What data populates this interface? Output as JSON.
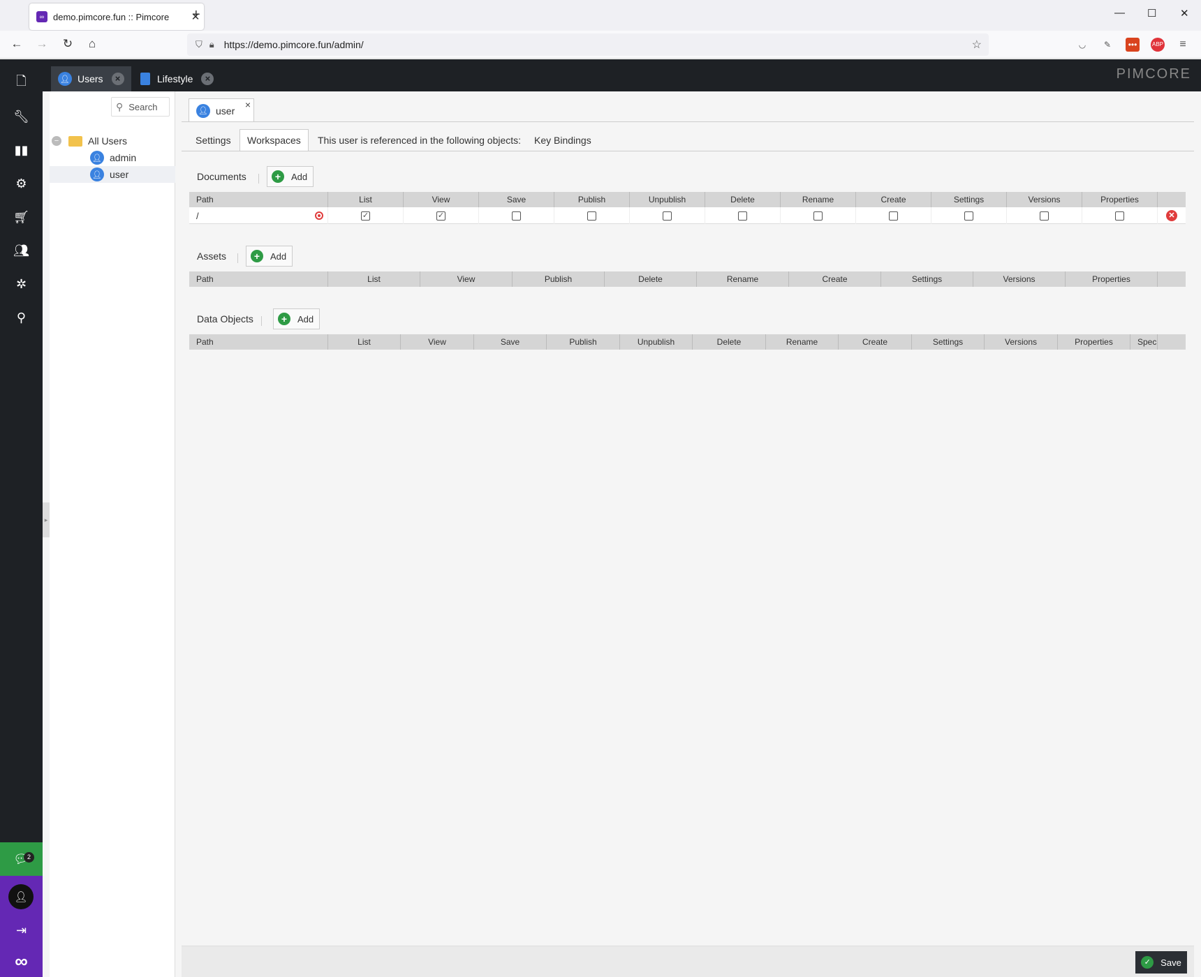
{
  "browser": {
    "tab_title": "demo.pimcore.fun :: Pimcore",
    "tab_close": "✕",
    "new_tab": "+",
    "url": "https://demo.pimcore.fun/admin/"
  },
  "app": {
    "brand": "PIMCORE",
    "top_tabs": [
      {
        "label": "Users"
      },
      {
        "label": "Lifestyle"
      }
    ],
    "notifications_count": "2"
  },
  "tree": {
    "search_label": "Search",
    "root": "All Users",
    "users": [
      "admin",
      "user"
    ]
  },
  "editor": {
    "tab_label": "user",
    "subtabs": [
      "Settings",
      "Workspaces",
      "This user is referenced in the following objects:",
      "Key Bindings"
    ],
    "add_label": "Add",
    "documents": {
      "title": "Documents",
      "columns": [
        "Path",
        "List",
        "View",
        "Save",
        "Publish",
        "Unpublish",
        "Delete",
        "Rename",
        "Create",
        "Settings",
        "Versions",
        "Properties"
      ],
      "rows": [
        {
          "path": "/",
          "checked": [
            true,
            true,
            false,
            false,
            false,
            false,
            false,
            false,
            false,
            false,
            false
          ]
        }
      ]
    },
    "assets": {
      "title": "Assets",
      "columns": [
        "Path",
        "List",
        "View",
        "Publish",
        "Delete",
        "Rename",
        "Create",
        "Settings",
        "Versions",
        "Properties"
      ]
    },
    "data_objects": {
      "title": "Data Objects",
      "columns": [
        "Path",
        "List",
        "View",
        "Save",
        "Publish",
        "Unpublish",
        "Delete",
        "Rename",
        "Create",
        "Settings",
        "Versions",
        "Properties",
        "Speci"
      ]
    },
    "save_label": "Save"
  },
  "colors": {
    "accent_purple": "#6428b4",
    "green": "#2e9b45",
    "blue": "#3a82e0",
    "red": "#e03c3c"
  }
}
